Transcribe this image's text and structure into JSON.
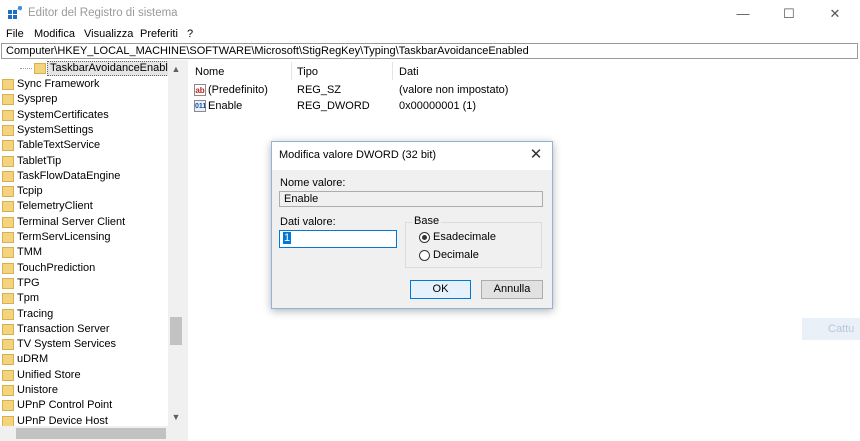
{
  "window": {
    "title": "Editor del Registro di sistema",
    "minimize_glyph": "—",
    "maximize_glyph": "☐",
    "close_glyph": "✕"
  },
  "menu": [
    "File",
    "Modifica",
    "Visualizza",
    "Preferiti",
    "?"
  ],
  "address": "Computer\\HKEY_LOCAL_MACHINE\\SOFTWARE\\Microsoft\\StigRegKey\\Typing\\TaskbarAvoidanceEnabled",
  "tree": {
    "selected_item": "TaskbarAvoidanceEnabled",
    "items": [
      "Sync Framework",
      "Sysprep",
      "SystemCertificates",
      "SystemSettings",
      "TableTextService",
      "TabletTip",
      "TaskFlowDataEngine",
      "Tcpip",
      "TelemetryClient",
      "Terminal Server Client",
      "TermServLicensing",
      "TMM",
      "TouchPrediction",
      "TPG",
      "Tpm",
      "Tracing",
      "Transaction Server",
      "TV System Services",
      "uDRM",
      "Unified Store",
      "Unistore",
      "UPnP Control Point",
      "UPnP Device Host"
    ]
  },
  "list": {
    "headers": [
      "Nome",
      "Tipo",
      "Dati"
    ],
    "rows": [
      {
        "icon": "ab",
        "name": "(Predefinito)",
        "type": "REG_SZ",
        "data": "(valore non impostato)"
      },
      {
        "icon": "011",
        "name": "Enable",
        "type": "REG_DWORD",
        "data": "0x00000001 (1)"
      }
    ]
  },
  "background_hint": "Cattu",
  "dialog": {
    "title": "Modifica valore DWORD (32 bit)",
    "name_label": "Nome valore:",
    "name_value": "Enable",
    "data_label": "Dati valore:",
    "data_value": "1",
    "base_label": "Base",
    "radio_hex": "Esadecimale",
    "radio_dec": "Decimale",
    "selected_base": "hex",
    "ok_label": "OK",
    "cancel_label": "Annulla"
  },
  "colors": {
    "accent": "#0078d7",
    "folder": "#f3d37d"
  }
}
